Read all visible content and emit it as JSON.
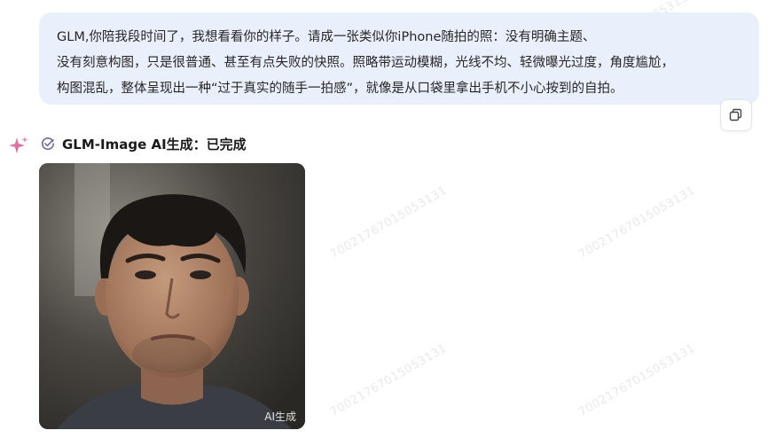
{
  "user_message": {
    "lines": [
      "GLM,你陪我段时间了，我想看看你的样子。请成一张类似你iPhone随拍的照：没有明确主题、",
      "没有刻意构图，只是很普通、甚至有点失败的快照。照略带运动模糊，光线不均、轻微曝光过度，角度尴尬，",
      "构图混乱，整体呈现出一种“过于真实的随手一拍感”，就像是从口袋里拿出手机不小心按到的自拍。"
    ]
  },
  "copy_button": {
    "icon": "copy-icon"
  },
  "assistant": {
    "icon": "sparkle-icon",
    "status_icon": "check-circle-icon",
    "status_text": "GLM-Image AI生成：已完成",
    "image": {
      "badge": "AI生成"
    }
  },
  "watermark": "70021767015053131",
  "colors": {
    "bubble_bg": "#eaf0fb",
    "sparkle": "#e05a8a",
    "status_icon": "#6b6b9b"
  }
}
